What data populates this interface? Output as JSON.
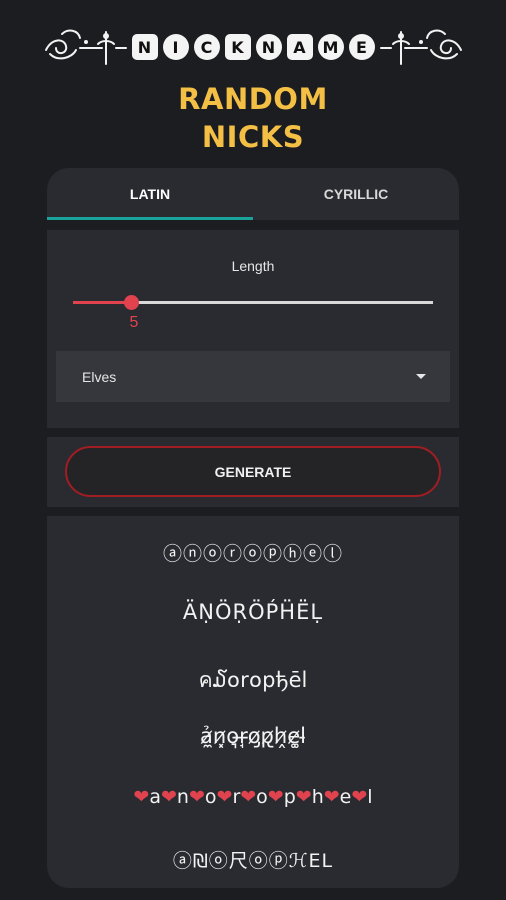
{
  "header": {
    "letters": [
      "N",
      "I",
      "C",
      "K",
      "N",
      "A",
      "M",
      "E"
    ],
    "left_ornament_icon": "flourish-ornament-icon",
    "right_ornament_icon": "flourish-ornament-icon"
  },
  "title": {
    "line1": "RANDOM",
    "line2": "NICKS"
  },
  "tabs": [
    {
      "label": "LATIN",
      "active": true
    },
    {
      "label": "CYRILLIC",
      "active": false
    }
  ],
  "settings": {
    "length_label": "Length",
    "length_value": "5",
    "length_fraction": 0.16,
    "race_selected": "Elves"
  },
  "generate_label": "GENERATE",
  "results": [
    "ⓐⓝⓞⓡⓞⓟⓗⓔⓛ",
    "ÄṆÖṚÖṔḦËḶ",
    "ค໓໐r໐pђēl",
    "ả̷̼n̷͓o̵͉r̶̘o̷̡p̷̢h̷̭e̷͚l̵",
    "❤a❤n❤o❤r❤o❤p❤h❤e❤l",
    "ⓐ₪ⓞ尺ⓞⓟℋEL"
  ],
  "colors": {
    "accent_red": "#e0434e",
    "tab_indicator": "#1aa39a",
    "title_yellow": "#f4bf45",
    "background": "#1c1d21",
    "card": "#2a2b30"
  }
}
